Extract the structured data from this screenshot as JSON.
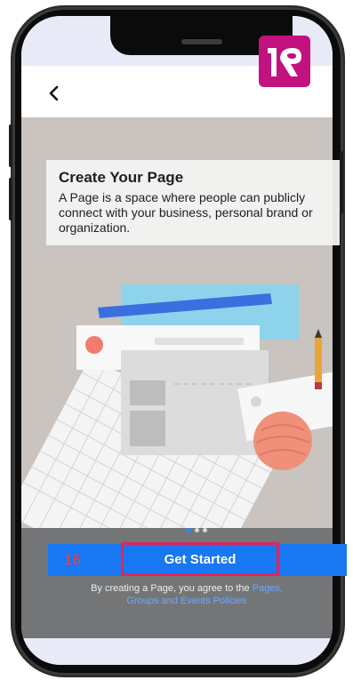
{
  "app_logo": {
    "color": "#c2127f",
    "icon": "app-logo-icon"
  },
  "nav": {
    "back_icon": "chevron-left-icon"
  },
  "intro": {
    "title": "Create Your Page",
    "body": "A Page is a space where people can publicly connect with your business, personal brand or organization."
  },
  "pager": {
    "count": 3,
    "active": 0
  },
  "cta": {
    "step_number": "16",
    "label": "Get Started",
    "color": "#1877f2"
  },
  "terms": {
    "prefix": "By creating a Page, you agree to the ",
    "link_1": "Pages,",
    "link_2": "Groups and Events Policies"
  }
}
